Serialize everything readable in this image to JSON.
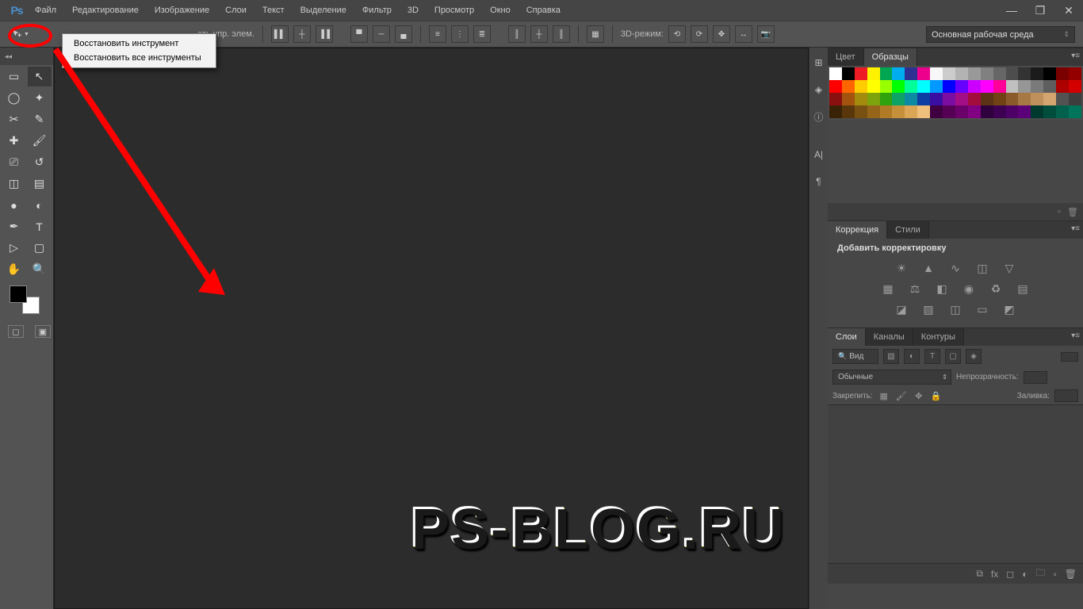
{
  "app": {
    "logo": "Ps"
  },
  "menus": [
    "Файл",
    "Редактирование",
    "Изображение",
    "Слои",
    "Текст",
    "Выделение",
    "Фильтр",
    "3D",
    "Просмотр",
    "Окно",
    "Справка"
  ],
  "window_controls": {
    "min": "—",
    "max": "❐",
    "close": "✕"
  },
  "options": {
    "fragment_label": "ать упр. элем.",
    "mode_label": "3D-режим:"
  },
  "workspace": {
    "selected": "Основная рабочая среда"
  },
  "context_menu": {
    "items": [
      "Восстановить инструмент",
      "Восстановить все инструменты"
    ]
  },
  "panels": {
    "swatches": {
      "tabs": [
        "Цвет",
        "Образцы"
      ],
      "active": 1
    },
    "adjustments": {
      "tabs": [
        "Коррекция",
        "Стили"
      ],
      "active": 0,
      "title": "Добавить корректировку"
    },
    "layers": {
      "tabs": [
        "Слои",
        "Каналы",
        "Контуры"
      ],
      "active": 0,
      "search_kind": "Вид",
      "blend_mode": "Обычные",
      "opacity_label": "Непрозрачность:",
      "lock_label": "Закрепить:",
      "fill_label": "Заливка:"
    }
  },
  "swatch_colors": [
    "#ffffff",
    "#000000",
    "#ed1c24",
    "#fff200",
    "#00a651",
    "#00aeef",
    "#2e3192",
    "#ec008c",
    "#f7f7f7",
    "#cccccc",
    "#b3b3b3",
    "#999999",
    "#808080",
    "#666666",
    "#4d4d4d",
    "#333333",
    "#1a1a1a",
    "#000000",
    "#7b0000",
    "#940000",
    "#ff0000",
    "#ff6600",
    "#ffcc00",
    "#ffff00",
    "#99ff00",
    "#00ff00",
    "#00ff99",
    "#00ffff",
    "#0099ff",
    "#0000ff",
    "#6600ff",
    "#cc00ff",
    "#ff00ff",
    "#ff0099",
    "#c0c0c0",
    "#969696",
    "#7a7a7a",
    "#5e5e5e",
    "#ad0000",
    "#d40000",
    "#8a0f0f",
    "#a3530d",
    "#a38c0d",
    "#7da30d",
    "#2ea30d",
    "#0da367",
    "#0d8aa3",
    "#0d3ea3",
    "#3a0da3",
    "#7c0da3",
    "#a30d85",
    "#a30d3e",
    "#5c3317",
    "#704214",
    "#8a5a2b",
    "#a67843",
    "#bf8f5c",
    "#d4a56f",
    "#525252",
    "#3d3d3d",
    "#3a2206",
    "#59370b",
    "#785012",
    "#95651a",
    "#b07b24",
    "#c6903a",
    "#dba756",
    "#eec07b",
    "#400040",
    "#550055",
    "#6b006b",
    "#820082",
    "#2e003e",
    "#3d0052",
    "#4d0066",
    "#5c007a",
    "#003a2e",
    "#004d3d",
    "#00614d",
    "#00755c"
  ],
  "watermark": "PS-BLOG.RU"
}
